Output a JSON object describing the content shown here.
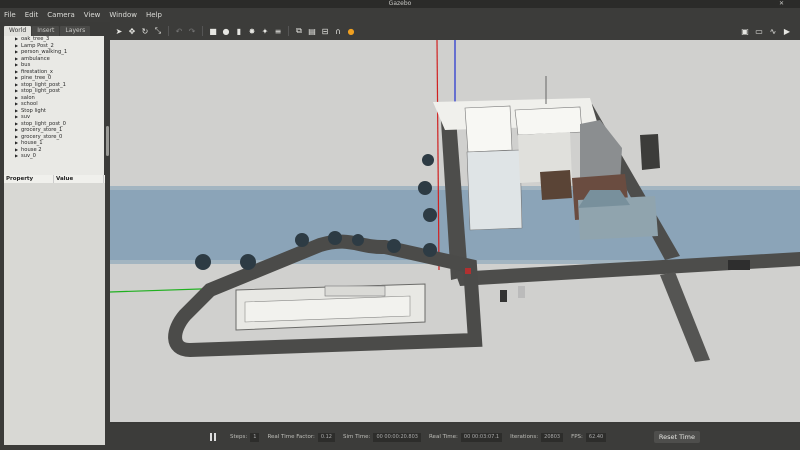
{
  "window": {
    "title": "Gazebo",
    "close_label": "✕"
  },
  "menu": [
    "File",
    "Edit",
    "Camera",
    "View",
    "Window",
    "Help"
  ],
  "panel": {
    "tabs": [
      "World",
      "Insert",
      "Layers"
    ],
    "active_tab": "World",
    "tree_items": [
      "oak_tree_3",
      "Lamp Post_2",
      "person_walking_1",
      "ambulance",
      "bus",
      "firestation_x",
      "pine_tree_0",
      "stop_light_post_1",
      "stop_light_post",
      "salon",
      "school",
      "Stop light",
      "suv",
      "stop_light_post_0",
      "grocery_store_1",
      "grocery_store_0",
      "house_1",
      "house 2",
      "suv_0"
    ],
    "prop_headers": [
      "Property",
      "Value"
    ]
  },
  "toolbar": {
    "left_icons": [
      "select-icon",
      "translate-icon",
      "rotate-icon",
      "scale-icon",
      "undo-icon",
      "redo-icon",
      "box-icon",
      "sphere-icon",
      "cylinder-icon",
      "point-light-icon",
      "spot-light-icon",
      "directional-light-icon",
      "copy-icon",
      "paste-icon",
      "align-icon",
      "snap-icon",
      "orange-light-icon"
    ],
    "right_icons": [
      "screenshot-icon",
      "log-icon",
      "plot-icon",
      "video-icon"
    ]
  },
  "status": {
    "steps_label": "Steps:",
    "steps_value": "1",
    "rtf_label": "Real Time Factor:",
    "rtf_value": "0.12",
    "sim_time_label": "Sim Time:",
    "sim_time_value": "00 00:00:20.803",
    "real_time_label": "Real Time:",
    "real_time_value": "00 00:03:07.1",
    "iterations_label": "Iterations:",
    "iterations_value": "20803",
    "fps_label": "FPS:",
    "fps_value": "62.40",
    "reset_label": "Reset Time"
  },
  "colors": {
    "background": "#3c3c3a",
    "viewport": "#cfcfcd",
    "axis_red": "#d02020",
    "axis_blue": "#2030d0",
    "axis_green": "#20b020"
  }
}
